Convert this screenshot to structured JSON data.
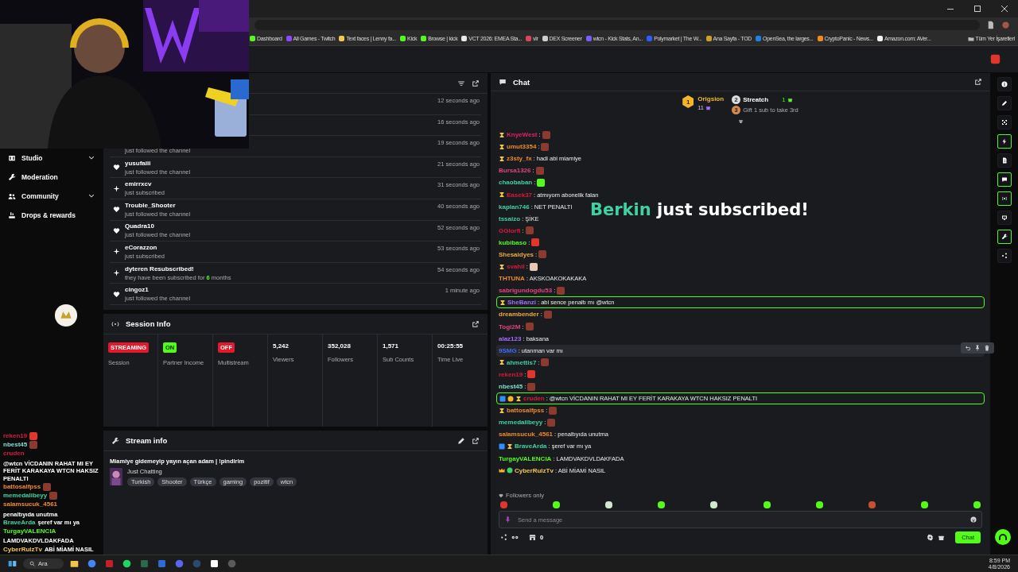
{
  "bookmarks": [
    {
      "label": "Dashboard",
      "color": "#53fc18"
    },
    {
      "label": "All Games - Twitch",
      "color": "#9146ff"
    },
    {
      "label": "Text faces | Lenny fa...",
      "color": "#f2c94c"
    },
    {
      "label": "Kick",
      "color": "#53fc18"
    },
    {
      "label": "Browse | kick",
      "color": "#53fc18"
    },
    {
      "label": "VCT 2026: EMEA Sta...",
      "color": "#e8e8e8"
    },
    {
      "label": "vlr",
      "color": "#d9475a"
    },
    {
      "label": "DEX Screener",
      "color": "#cfcfcf"
    },
    {
      "label": "wtcn - Kick Stats, An...",
      "color": "#7c5cff"
    },
    {
      "label": "Polymarket | The W...",
      "color": "#2e5cff"
    },
    {
      "label": "Ana Sayfa - TOD",
      "color": "#c9a227"
    },
    {
      "label": "OpenSea, the larges...",
      "color": "#2081e2"
    },
    {
      "label": "CryptoPanic - News...",
      "color": "#f08a24"
    },
    {
      "label": "Amazon.com: AVer...",
      "color": "#f3f3f3"
    }
  ],
  "all_bookmarks": "Tüm Yer İşaretleri",
  "sidebar": {
    "items": [
      {
        "label": "Studio",
        "expandable": true
      },
      {
        "label": "Moderation",
        "expandable": false
      },
      {
        "label": "Community",
        "expandable": true
      },
      {
        "label": "Drops & rewards",
        "expandable": false
      }
    ]
  },
  "activity_feed": {
    "events": [
      {
        "time": "12 seconds ago"
      },
      {
        "time": "16 seconds ago"
      },
      {
        "subtitle": "just followed the channel",
        "time": "19 seconds ago"
      },
      {
        "kind": "follow",
        "name": "yusufaiii",
        "subtitle": "just followed the channel",
        "time": "21 seconds ago"
      },
      {
        "kind": "subscribe",
        "name": "emirrxcv",
        "subtitle": "just subscribed",
        "time": "31 seconds ago"
      },
      {
        "kind": "follow",
        "name": "Trouble_Shooter",
        "subtitle": "just followed the channel",
        "time": "40 seconds ago"
      },
      {
        "kind": "follow",
        "name": "Quadra10",
        "subtitle": "just followed the channel",
        "time": "52 seconds ago"
      },
      {
        "kind": "subscribe",
        "name": "eCorazzon",
        "subtitle": "just subscribed",
        "time": "53 seconds ago"
      },
      {
        "kind": "subscribe",
        "name": "dyteren Resubscribed!",
        "subtitle": "they have been subscribed for **6** months",
        "time": "54 seconds ago"
      },
      {
        "kind": "follow",
        "name": "cingoz1",
        "subtitle": "just followed the channel",
        "time": "1 minute ago"
      }
    ]
  },
  "session_info": {
    "title": "Session Info",
    "stats": [
      {
        "kind": "badge",
        "value": "STREAMING",
        "label": "Session",
        "color": "#e01a2b"
      },
      {
        "kind": "badge",
        "value": "ON",
        "label": "Partner Income",
        "color": "#53fc18"
      },
      {
        "kind": "badge",
        "value": "OFF",
        "label": "Multistream",
        "color": "#e01a2b"
      },
      {
        "kind": "number",
        "value": "5,242",
        "label": "Viewers"
      },
      {
        "kind": "number",
        "value": "352,028",
        "label": "Followers"
      },
      {
        "kind": "number",
        "value": "1,571",
        "label": "Sub Counts"
      },
      {
        "kind": "number",
        "value": "00:25:55",
        "label": "Time Live"
      }
    ]
  },
  "stream_info": {
    "title": "Stream info",
    "stream_title": "Miamiye gidemeyip yayın açan adam | !pindirim",
    "category": "Just Chatting",
    "tags": [
      "Turkish",
      "Shooter",
      "Türkçe",
      "gaming",
      "pozitif",
      "wtcn"
    ]
  },
  "chat": {
    "title": "Chat",
    "leaders": [
      {
        "rank": "1",
        "name": "Origsion",
        "count": "11"
      },
      {
        "rank": "2",
        "name": "Streatch",
        "count": "1"
      }
    ],
    "next_rank": "3",
    "hint": "Gift 1 sub to take 3rd",
    "messages": [
      {
        "name": "KnyeWest",
        "color": "#e0245e",
        "text": ":",
        "badges": [
          {
            "kind": "hourglass"
          }
        ],
        "emote": {
          "kind": "face"
        },
        "highlighted": false,
        "hovered": false
      },
      {
        "name": "umut3354",
        "color": "#f08a24",
        "text": ":",
        "badges": [
          {
            "kind": "hourglass"
          }
        ],
        "emote": {
          "kind": "face"
        },
        "highlighted": false,
        "hovered": false
      },
      {
        "name": "z3sty_fx",
        "color": "#f08a24",
        "text": ": hadi abi miamiye",
        "badges": [
          {
            "kind": "hourglass"
          }
        ],
        "highlighted": false,
        "hovered": false
      },
      {
        "name": "Bursa1326",
        "color": "#e0457b",
        "text": ":",
        "emote": {
          "kind": "face"
        },
        "highlighted": false,
        "hovered": false
      },
      {
        "name": "chaobaban",
        "color": "#3fd1a0",
        "text": ":",
        "emote": {
          "kind": "green"
        },
        "highlighted": false,
        "hovered": false
      },
      {
        "name": "Easek37",
        "color": "#d81b3a",
        "text": ": atmıyom abonelik falan",
        "badges": [
          {
            "kind": "hourglass"
          }
        ],
        "highlighted": false,
        "hovered": false
      },
      {
        "name": "kaplan746",
        "color": "#3fd1a0",
        "text": ": NET PENALTI",
        "highlighted": false,
        "hovered": false
      },
      {
        "name": "tssaizo",
        "color": "#3fd1a0",
        "text": ": ŞİKE",
        "highlighted": false,
        "hovered": false
      },
      {
        "name": "GGlorfi",
        "color": "#d81b3a",
        "text": ":",
        "emote": {
          "kind": "face"
        },
        "highlighted": false,
        "hovered": false
      },
      {
        "name": "kubibaso",
        "color": "#53fc18",
        "text": ":",
        "emote": {
          "kind": "red"
        },
        "highlighted": false,
        "hovered": false
      },
      {
        "name": "Shesaidyes",
        "color": "#f2a93b",
        "text": ":",
        "emote": {
          "kind": "face"
        },
        "highlighted": false,
        "hovered": false
      },
      {
        "name": "svahil",
        "color": "#d81b3a",
        "text": ":",
        "badges": [
          {
            "kind": "hourglass"
          }
        ],
        "emote": {
          "kind": "hand"
        },
        "highlighted": false,
        "hovered": false
      },
      {
        "name": "THTUNA",
        "color": "#f08a24",
        "text": ": AKSKOAKOKAKAKA",
        "highlighted": false,
        "hovered": false
      },
      {
        "name": "sabrigundogdu53",
        "color": "#e0457b",
        "text": ":",
        "emote": {
          "kind": "face"
        },
        "highlighted": false,
        "hovered": false
      },
      {
        "name": "SheBanzi",
        "color": "#a56cff",
        "text": ": abi sence penaltı mı @wtcn",
        "badges": [
          {
            "kind": "hourglass"
          }
        ],
        "highlighted": true,
        "hovered": false
      },
      {
        "name": "dreambender",
        "color": "#f2a93b",
        "text": ":",
        "emote": {
          "kind": "face"
        },
        "highlighted": false,
        "hovered": false
      },
      {
        "name": "Togi2M",
        "color": "#e0457b",
        "text": ":",
        "emote": {
          "kind": "face"
        },
        "highlighted": false,
        "hovered": false
      },
      {
        "name": "alaz123",
        "color": "#a56cff",
        "text": ": baksana",
        "highlighted": false,
        "hovered": false
      },
      {
        "name": "9SMG",
        "color": "#3b6cff",
        "text": ": utanman var mı",
        "highlighted": false,
        "hovered": true
      },
      {
        "name": "ahmettis7",
        "color": "#3fd1a0",
        "text": ":",
        "badges": [
          {
            "kind": "hourglass"
          }
        ],
        "emote": {
          "kind": "face"
        },
        "highlighted": false,
        "hovered": false
      },
      {
        "name": "reken19",
        "color": "#d81b3a",
        "text": ":",
        "emote": {
          "kind": "red"
        },
        "highlighted": false,
        "hovered": false
      },
      {
        "name": "nbest45",
        "color": "#7fe0d0",
        "text": ":",
        "emote": {
          "kind": "face"
        },
        "highlighted": false,
        "hovered": false
      },
      {
        "name": "cruden",
        "color": "#d81b3a",
        "text": ": @wtcn VİCDANIN RAHAT MI EY FERİT KARAKAYA WTCN HAKSIZ PENALTI",
        "badges": [
          {
            "kind": "moderator"
          },
          {
            "kind": "coin"
          },
          {
            "kind": "hourglass"
          }
        ],
        "highlighted": true,
        "hovered": false
      },
      {
        "name": "battosalfpss",
        "color": "#f08a24",
        "text": ":",
        "badges": [
          {
            "kind": "hourglass"
          }
        ],
        "emote": {
          "kind": "face"
        },
        "highlighted": false,
        "hovered": false
      },
      {
        "name": "memedalibeyy",
        "color": "#3fd1a0",
        "text": ":",
        "emote": {
          "kind": "face"
        },
        "highlighted": false,
        "hovered": false
      },
      {
        "name": "salamsucuk_4561",
        "color": "#f08a24",
        "text": ": penaltıyıda unutma",
        "highlighted": false,
        "hovered": false
      },
      {
        "name": "BraveArda",
        "color": "#3fd1a0",
        "text": ": şeref var mı ya",
        "badges": [
          {
            "kind": "moderator"
          },
          {
            "kind": "hourglass"
          }
        ],
        "highlighted": false,
        "hovered": false
      },
      {
        "name": "TurgayVALENCIA",
        "color": "#53fc18",
        "text": ": LAMDVAKDVLDAKFADA",
        "highlighted": false,
        "hovered": false
      },
      {
        "name": "CyberRulzTv",
        "color": "#f2c94c",
        "text": ": ABİ MİAMİ NASIL",
        "badges": [
          {
            "kind": "crown"
          },
          {
            "kind": "verified"
          }
        ],
        "highlighted": false,
        "hovered": false
      }
    ],
    "alert": {
      "name": "Berkin",
      "text": "just subscribed!"
    },
    "followers_only": "Followers only",
    "emotes": [
      {
        "kind": "red"
      },
      {
        "kind": "green"
      },
      {
        "kind": "frog"
      },
      {
        "kind": "green"
      },
      {
        "kind": "frog"
      },
      {
        "kind": "green"
      },
      {
        "kind": "green"
      },
      {
        "kind": "bear"
      },
      {
        "kind": "green"
      },
      {
        "kind": "green"
      }
    ],
    "input": {
      "placeholder": "Send a message"
    },
    "points": "0",
    "send_button": "Chat"
  },
  "rail": [
    {
      "on": false
    },
    {
      "on": false
    },
    {
      "on": false
    },
    {
      "on": true
    },
    {
      "on": false
    },
    {
      "on": true
    },
    {
      "on": true
    },
    {
      "on": false
    },
    {
      "on": true
    },
    {
      "on": false
    }
  ],
  "overlay_chat": [
    {
      "name": "reken19",
      "color": "#d81b3a",
      "emote": {
        "kind": "red"
      }
    },
    {
      "name": "nbest45",
      "color": "#7fe0d0",
      "emote": {
        "kind": "face"
      }
    },
    {
      "name": "cruden",
      "color": "#d81b3a",
      "text": "@wtcn VİCDANIN RAHAT MI EY FERİT KARAKAYA WTCN HAKSIZ PENALTI"
    },
    {
      "name": "battosalfpss",
      "color": "#f08a24",
      "emote": {
        "kind": "face"
      }
    },
    {
      "name": "memedalibeyy",
      "color": "#3fd1a0",
      "emote": {
        "kind": "face"
      }
    },
    {
      "name": "salamsucuk_4561",
      "color": "#f08a24",
      "text": "penaltıyıda unutma"
    },
    {
      "name": "BraveArda",
      "color": "#3fd1a0",
      "text": "şeref var mı ya"
    },
    {
      "name": "TurgayVALENCIA",
      "color": "#53fc18",
      "text": "LAMDVAKDVLDAKFADA"
    },
    {
      "name": "CyberRulzTv",
      "color": "#f2c94c",
      "text": "ABİ MİAMİ NASIL"
    }
  ],
  "taskbar": {
    "search": "Ara",
    "apps": [
      {
        "kind": "folder"
      },
      {
        "kind": "chrome"
      },
      {
        "kind": "news"
      },
      {
        "kind": "spotify"
      },
      {
        "kind": "xbox"
      },
      {
        "kind": "editor"
      },
      {
        "kind": "discord"
      },
      {
        "kind": "steam"
      },
      {
        "kind": "box"
      },
      {
        "kind": "obs"
      }
    ],
    "time": "8:59 PM",
    "date": "4/8/2026"
  }
}
